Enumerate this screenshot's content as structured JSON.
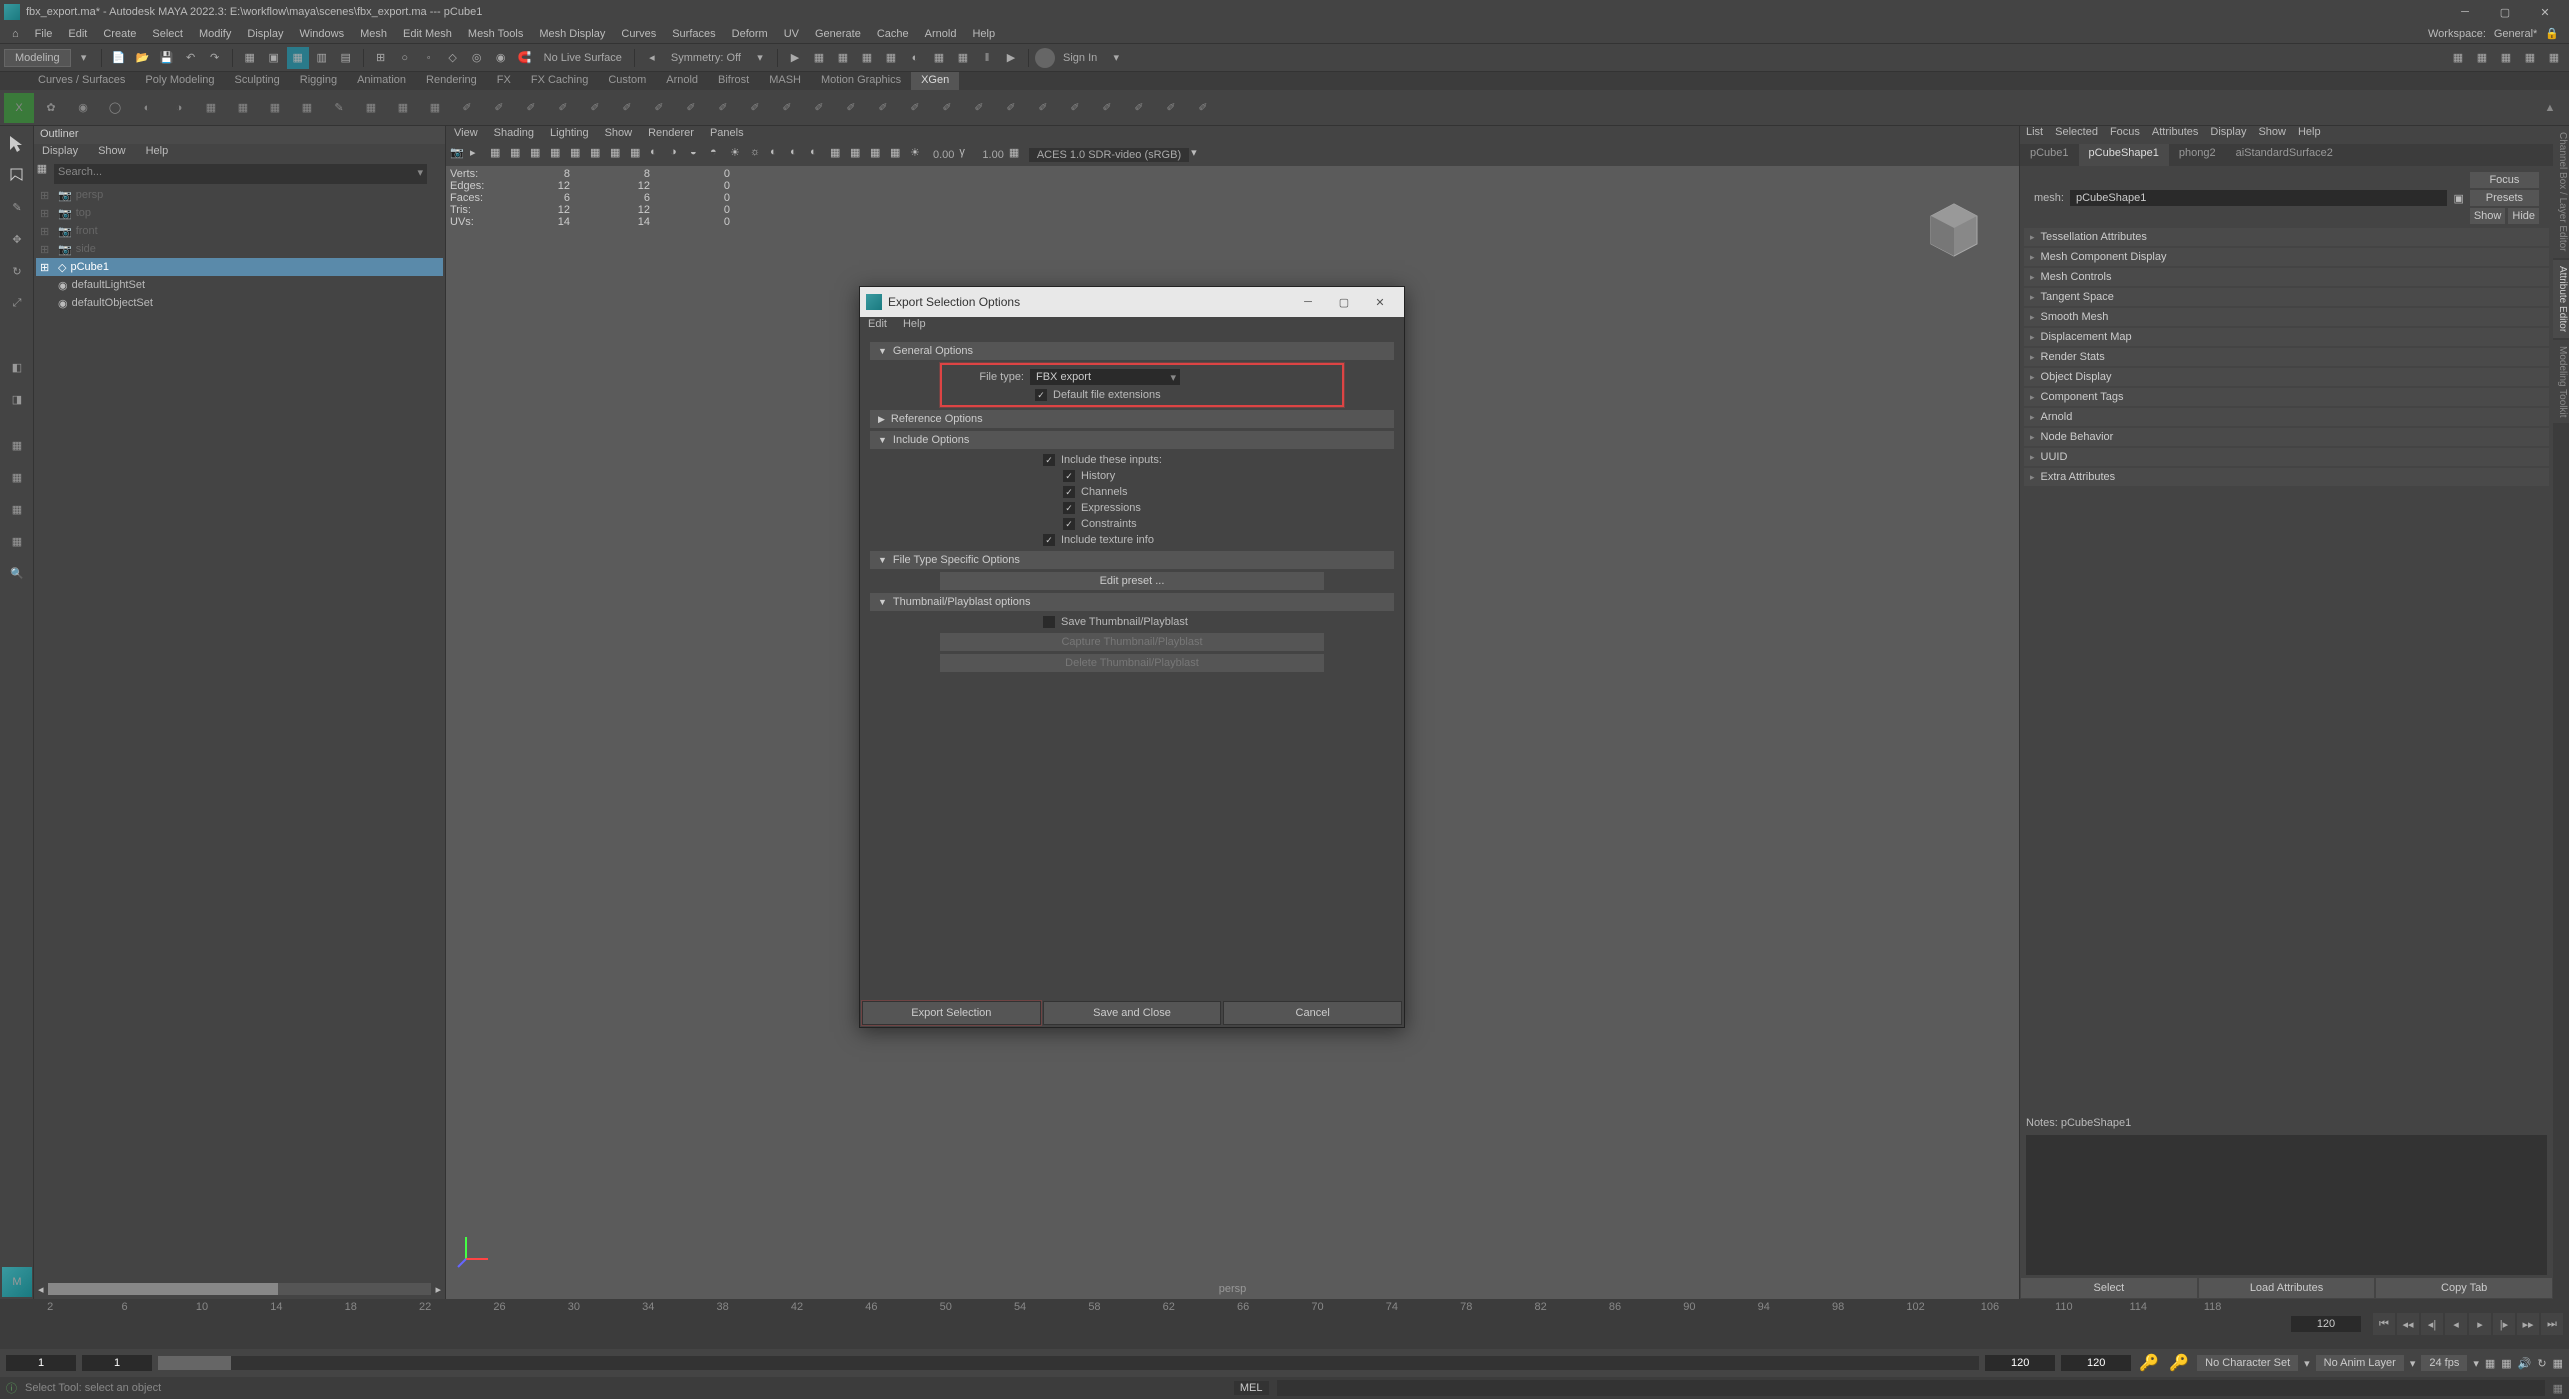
{
  "window": {
    "title": "fbx_export.ma* - Autodesk MAYA 2022.3:  E:\\workflow\\maya\\scenes\\fbx_export.ma  ---  pCube1"
  },
  "menu_bar": {
    "items": [
      "File",
      "Edit",
      "Create",
      "Select",
      "Modify",
      "Display",
      "Windows",
      "Mesh",
      "Edit Mesh",
      "Mesh Tools",
      "Mesh Display",
      "Curves",
      "Surfaces",
      "Deform",
      "UV",
      "Generate",
      "Cache",
      "Arnold",
      "Help"
    ],
    "workspace_label": "Workspace:",
    "workspace_value": "General*"
  },
  "main_toolbar": {
    "module_dropdown": "Modeling",
    "no_live_surface": "No Live Surface",
    "symmetry": "Symmetry: Off",
    "sign_in": "Sign In"
  },
  "shelf": {
    "tabs": [
      "Curves / Surfaces",
      "Poly Modeling",
      "Sculpting",
      "Rigging",
      "Animation",
      "Rendering",
      "FX",
      "FX Caching",
      "Custom",
      "Arnold",
      "Bifrost",
      "MASH",
      "Motion Graphics",
      "XGen"
    ],
    "active_tab": "XGen",
    "active_tab_index": 13
  },
  "outliner": {
    "title": "Outliner",
    "menu": [
      "Display",
      "Show",
      "Help"
    ],
    "search_placeholder": "Search...",
    "items": [
      {
        "name": "persp",
        "dim": true
      },
      {
        "name": "top",
        "dim": true
      },
      {
        "name": "front",
        "dim": true
      },
      {
        "name": "side",
        "dim": true
      },
      {
        "name": "pCube1",
        "selected": true
      },
      {
        "name": "defaultLightSet"
      },
      {
        "name": "defaultObjectSet"
      }
    ]
  },
  "viewport": {
    "menu": [
      "View",
      "Shading",
      "Lighting",
      "Show",
      "Renderer",
      "Panels"
    ],
    "exposure_val": "0.00",
    "gamma_val": "1.00",
    "color_space": "ACES 1.0 SDR-video (sRGB)",
    "camera_label": "persp",
    "hud": {
      "rows": [
        {
          "label": "Verts:",
          "a": "8",
          "b": "8",
          "c": "0"
        },
        {
          "label": "Edges:",
          "a": "12",
          "b": "12",
          "c": "0"
        },
        {
          "label": "Faces:",
          "a": "6",
          "b": "6",
          "c": "0"
        },
        {
          "label": "Tris:",
          "a": "12",
          "b": "12",
          "c": "0"
        },
        {
          "label": "UVs:",
          "a": "14",
          "b": "14",
          "c": "0"
        }
      ]
    }
  },
  "attribute_editor": {
    "menu": [
      "List",
      "Selected",
      "Focus",
      "Attributes",
      "Display",
      "Show",
      "Help"
    ],
    "tabs": [
      "pCube1",
      "pCubeShape1",
      "phong2",
      "aiStandardSurface2"
    ],
    "active_tab_index": 1,
    "mesh_label": "mesh:",
    "mesh_value": "pCubeShape1",
    "focus_btn": "Focus",
    "presets_btn": "Presets",
    "show_btn": "Show",
    "hide_btn": "Hide",
    "sections": [
      "Tessellation Attributes",
      "Mesh Component Display",
      "Mesh Controls",
      "Tangent Space",
      "Smooth Mesh",
      "Displacement Map",
      "Render Stats",
      "Object Display",
      "Component Tags",
      "Arnold",
      "Node Behavior",
      "UUID",
      "Extra Attributes"
    ],
    "notes_label": "Notes: pCubeShape1",
    "footer": [
      "Select",
      "Load Attributes",
      "Copy Tab"
    ],
    "side_tabs": [
      "Channel Box / Layer Editor",
      "Attribute Editor",
      "Modeling Toolkit"
    ]
  },
  "timeline": {
    "end_field": "120",
    "range": {
      "start": "1",
      "inner_start": "1",
      "inner_end": "120",
      "end": "120"
    },
    "char_set": "No Character Set",
    "anim_layer": "No Anim Layer",
    "fps": "24 fps"
  },
  "status_bar": {
    "hint": "Select Tool: select an object",
    "mel": "MEL"
  },
  "dialog": {
    "title": "Export Selection Options",
    "menu": [
      "Edit",
      "Help"
    ],
    "general_options": "General Options",
    "file_type_label": "File type:",
    "file_type_value": "FBX export",
    "default_ext": "Default file extensions",
    "reference_options": "Reference Options",
    "include_options": "Include Options",
    "include_inputs": "Include these inputs:",
    "history": "History",
    "channels": "Channels",
    "expressions": "Expressions",
    "constraints": "Constraints",
    "include_texture": "Include texture info",
    "file_type_specific": "File Type Specific Options",
    "edit_preset": "Edit preset ...",
    "thumbnail_section": "Thumbnail/Playblast options",
    "save_thumbnail": "Save Thumbnail/Playblast",
    "capture_thumbnail": "Capture Thumbnail/Playblast",
    "delete_thumbnail": "Delete Thumbnail/Playblast",
    "footer": [
      "Export Selection",
      "Save and Close",
      "Cancel"
    ]
  }
}
